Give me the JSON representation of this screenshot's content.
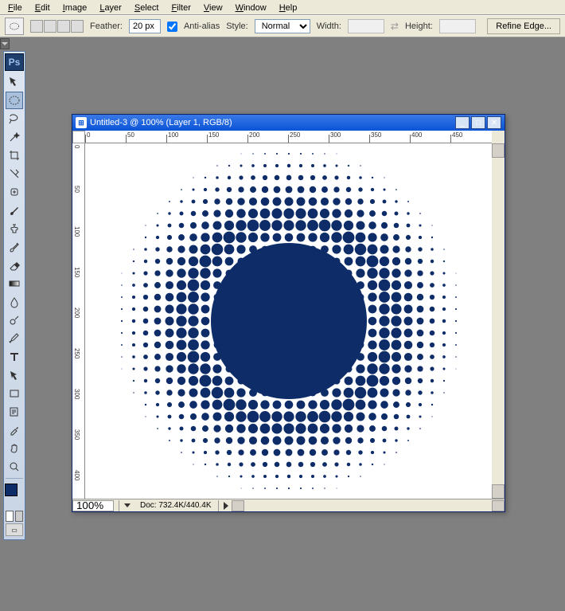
{
  "menu": {
    "items": [
      "File",
      "Edit",
      "Image",
      "Layer",
      "Select",
      "Filter",
      "View",
      "Window",
      "Help"
    ]
  },
  "options": {
    "feather_label": "Feather:",
    "feather_value": "20 px",
    "anti_alias_label": "Anti-alias",
    "anti_alias_checked": true,
    "style_label": "Style:",
    "style_value": "Normal",
    "width_label": "Width:",
    "height_label": "Height:",
    "refine_label": "Refine Edge..."
  },
  "toolbox": {
    "ps_label": "Ps",
    "tools": [
      "move",
      "marquee-ellipse",
      "lasso",
      "wand",
      "crop",
      "slice",
      "healing",
      "brush",
      "clone",
      "history-brush",
      "eraser",
      "gradient",
      "blur",
      "dodge",
      "pen",
      "type",
      "path-select",
      "shape",
      "notes",
      "eyedropper",
      "hand",
      "zoom"
    ],
    "selected": "marquee-ellipse",
    "fg_color": "#0e2d68",
    "bg_color": "#ffffff"
  },
  "document": {
    "title": "Untitled-3 @ 100% (Layer 1, RGB/8)",
    "zoom": "100%",
    "doc_info": "Doc: 732.4K/440.4K",
    "ruler_h": [
      0,
      50,
      100,
      150,
      200,
      250,
      300,
      350,
      400,
      450
    ],
    "ruler_v": [
      0,
      50,
      100,
      150,
      200,
      250,
      300,
      350,
      400
    ]
  },
  "halftone": {
    "color": "#0e2d68",
    "grid": 15,
    "max_r": 7,
    "rows": 31,
    "cols": 31
  }
}
